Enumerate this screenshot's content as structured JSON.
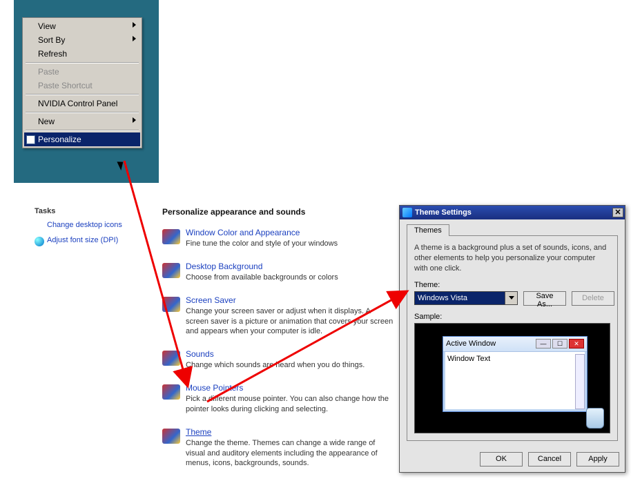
{
  "context_menu": {
    "items": [
      {
        "label": "View",
        "has_sub": true
      },
      {
        "label": "Sort By",
        "has_sub": true
      },
      {
        "label": "Refresh"
      },
      "sep",
      {
        "label": "Paste",
        "disabled": true
      },
      {
        "label": "Paste Shortcut",
        "disabled": true
      },
      "sep",
      {
        "label": "NVIDIA Control Panel"
      },
      "sep",
      {
        "label": "New",
        "has_sub": true
      },
      "sep",
      {
        "label": "Personalize",
        "selected": true,
        "icon": true
      }
    ]
  },
  "tasks": {
    "heading": "Tasks",
    "links": [
      {
        "label": "Change desktop icons"
      },
      {
        "label": "Adjust font size (DPI)",
        "icon": true
      }
    ]
  },
  "personalize": {
    "heading": "Personalize appearance and sounds",
    "items": [
      {
        "title": "Window Color and Appearance",
        "desc": "Fine tune the color and style of your windows"
      },
      {
        "title": "Desktop Background",
        "desc": "Choose from available backgrounds or colors"
      },
      {
        "title": "Screen Saver",
        "desc": "Change your screen saver or adjust when it displays. A screen saver is a picture or animation that covers your screen and appears when your computer is idle."
      },
      {
        "title": "Sounds",
        "desc": "Change which sounds are heard when you do things."
      },
      {
        "title": "Mouse Pointers",
        "desc": "Pick a different mouse pointer. You can also change how the pointer looks during clicking and selecting."
      },
      {
        "title": "Theme",
        "desc": "Change the theme. Themes can change a wide range of visual and auditory elements including the appearance of menus, icons, backgrounds, sounds.",
        "underline": true
      }
    ]
  },
  "dialog": {
    "title": "Theme Settings",
    "tab": "Themes",
    "help": "A theme is a background plus a set of sounds, icons, and other elements to help you personalize your computer with one click.",
    "theme_label": "Theme:",
    "theme_value": "Windows Vista",
    "save_as": "Save As...",
    "delete": "Delete",
    "sample_label": "Sample:",
    "active_window": "Active Window",
    "window_text": "Window Text",
    "ok": "OK",
    "cancel": "Cancel",
    "apply": "Apply"
  }
}
